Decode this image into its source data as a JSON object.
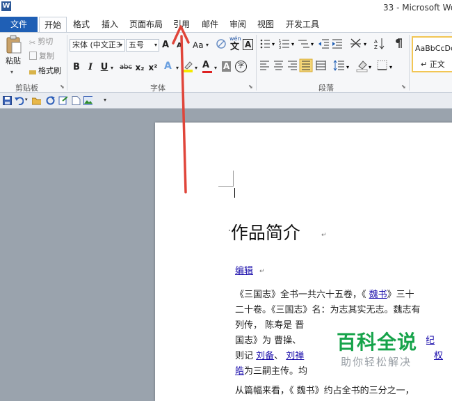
{
  "window": {
    "title": "33 - Microsoft Wo",
    "logo_letter": "W"
  },
  "tabs": [
    {
      "label": "文件"
    },
    {
      "label": "开始"
    },
    {
      "label": "格式"
    },
    {
      "label": "插入"
    },
    {
      "label": "页面布局"
    },
    {
      "label": "引用"
    },
    {
      "label": "邮件"
    },
    {
      "label": "审阅"
    },
    {
      "label": "视图"
    },
    {
      "label": "开发工具"
    }
  ],
  "clipboard": {
    "paste": "粘贴",
    "cut": "剪切",
    "copy": "复制",
    "format_painter": "格式刷",
    "group_label": "剪贴板"
  },
  "font": {
    "font_name": "宋体 (中文正3",
    "font_size": "五号",
    "grow": "A",
    "shrink": "A",
    "change_case": "Aa",
    "bold": "B",
    "italic": "I",
    "underline": "U",
    "strike": "abc",
    "subscript": "x₂",
    "superscript": "x²",
    "highlight_letter": "A",
    "font_color_letter": "A",
    "char_shading_letter": "A",
    "enclose": "字",
    "phonetic_top": "wén",
    "phonetic_char": "文",
    "border_letter": "A",
    "group_label": "字体"
  },
  "paragraph": {
    "group_label": "段落"
  },
  "styles": {
    "sample": "AaBbCcDc",
    "normal": "↵ 正文"
  },
  "document": {
    "heading": "作品简介",
    "edit_link": "编辑",
    "para_lines": [
      [
        "《三国志》全书一共六十五卷，《 ",
        "魏书",
        "》三十"
      ],
      [
        "二十卷。《三国志》名：为志其实无志。魏志有"
      ],
      [
        "列传， 陈寿是 晋"
      ],
      [
        "国志》为 曹操、"
      ],
      [
        "则记 ",
        "刘备",
        "、 ",
        "刘禅"
      ],
      [
        "皓",
        "为三嗣主传。均"
      ]
    ],
    "line3_tail": "纪",
    "line5_tail": "权",
    "next_para": "从篇幅来看，《 魏书》约占全书的三分之一，"
  },
  "watermark": {
    "title": "百科全说",
    "subtitle": "助你轻松解决"
  },
  "colors": {
    "file_tab": "#1f5fb5",
    "link": "#1a0dab",
    "watermark_green": "#16a34a",
    "arrow": "#e0453a",
    "style_highlight": "#f2c654"
  }
}
